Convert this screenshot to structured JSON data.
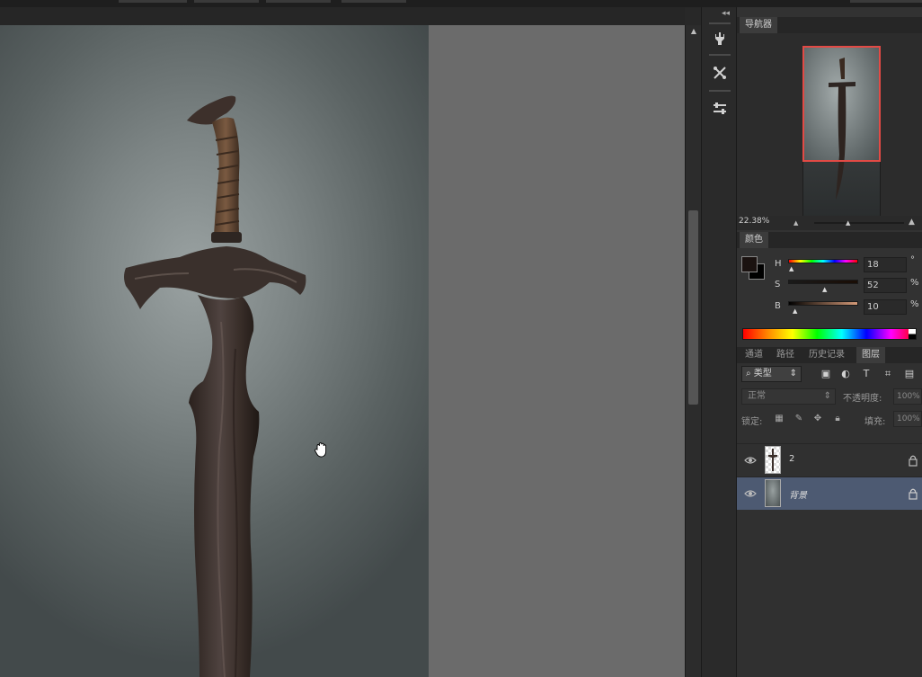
{
  "navigator": {
    "tab_label": "导航器",
    "zoom_value": "22.38%"
  },
  "color_panel": {
    "tab_label": "颜色",
    "h_label": "H",
    "s_label": "S",
    "b_label": "B",
    "h_value": "18",
    "s_value": "52",
    "b_value": "10",
    "h_unit": "°",
    "s_unit": "%",
    "b_unit": "%",
    "foreground_color": "#1a1210",
    "background_color": "#000000"
  },
  "layers_panel": {
    "tabs": [
      {
        "label": "通道"
      },
      {
        "label": "路径"
      },
      {
        "label": "历史记录"
      },
      {
        "label": "图层"
      }
    ],
    "filter_type": "类型",
    "blend_mode": "正常",
    "opacity_label": "不透明度:",
    "opacity_value": "100%",
    "lock_label": "锁定:",
    "fill_label": "填充:",
    "fill_value": "100%",
    "layers": [
      {
        "name": "2",
        "visible": true,
        "locked": true,
        "selected": false
      },
      {
        "name": "背景",
        "visible": true,
        "locked": true,
        "selected": true
      }
    ]
  },
  "icons": {
    "panel_collapse": "double-chevron-left-icon",
    "tool_1": "brush-preset-icon",
    "tool_2": "brush-settings-icon",
    "tool_3": "adjustment-sliders-icon",
    "cursor": "hand-cursor-icon"
  },
  "colors": {
    "selection_highlight": "#4d5a72",
    "navigator_view_box": "#e24a45"
  }
}
